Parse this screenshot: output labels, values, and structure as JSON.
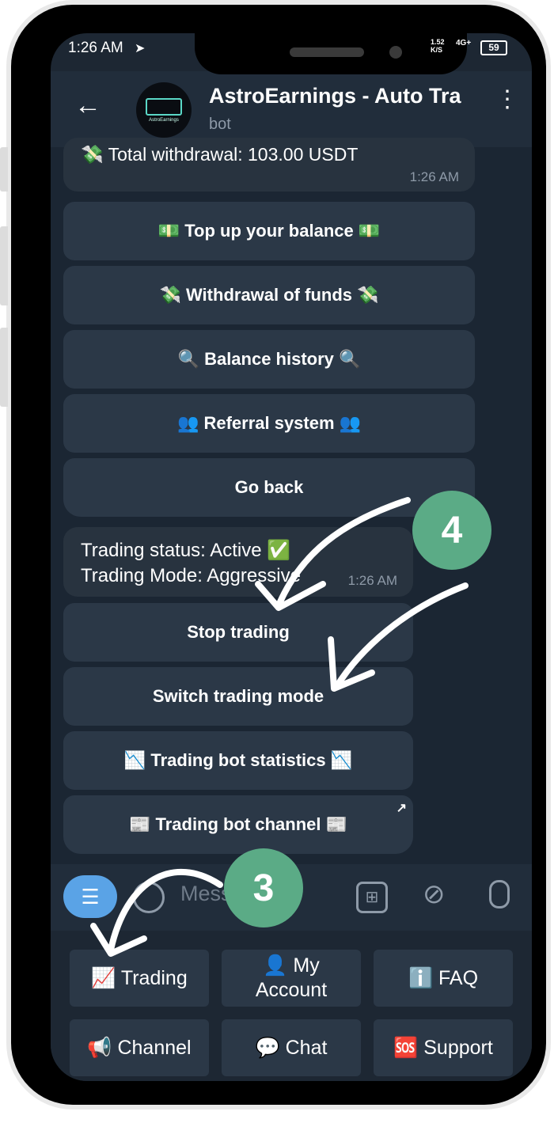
{
  "status_bar": {
    "time": "1:26 AM",
    "net_speed": "1.52 K/S",
    "signal": "4G+",
    "battery": "59"
  },
  "header": {
    "title": "AstroEarnings - Auto Tra",
    "subtitle": "bot",
    "avatar_text": "AstroEarnings"
  },
  "messages": {
    "withdrawal": {
      "text": "💸 Total withdrawal: 103.00 USDT",
      "time": "1:26 AM"
    },
    "trading": {
      "status_line": "Trading status: Active ✅",
      "mode_line": "Trading Mode: Aggressive",
      "time": "1:26 AM"
    }
  },
  "inline_keyboard_balance": [
    "💵 Top up your balance 💵",
    "💸 Withdrawal of funds 💸",
    "🔍 Balance history 🔍",
    "👥 Referral system 👥",
    "Go back"
  ],
  "inline_keyboard_trading": [
    "Stop trading",
    "Switch trading mode",
    "📉 Trading bot statistics 📉",
    "📰 Trading bot channel 📰"
  ],
  "input": {
    "placeholder": "Message"
  },
  "reply_keyboard": {
    "row1": [
      "📈 Trading",
      "👤 My Account",
      "ℹ️ FAQ"
    ],
    "row2": [
      "📢 Channel",
      "💬 Chat",
      "🆘 Support"
    ]
  },
  "annotations": {
    "badge_3": "3",
    "badge_4": "4"
  },
  "icons": [
    "arrow-back-icon",
    "more-vert-icon",
    "menu-icon",
    "emoji-icon",
    "apps-icon",
    "attach-icon",
    "mic-icon",
    "open-external-icon",
    "send-icon"
  ],
  "colors": {
    "chat_bg": "#1b2633",
    "header_bg": "#212d3b",
    "button_bg": "#2b3847",
    "accent": "#5aa3e6",
    "badge": "#5bab86"
  }
}
